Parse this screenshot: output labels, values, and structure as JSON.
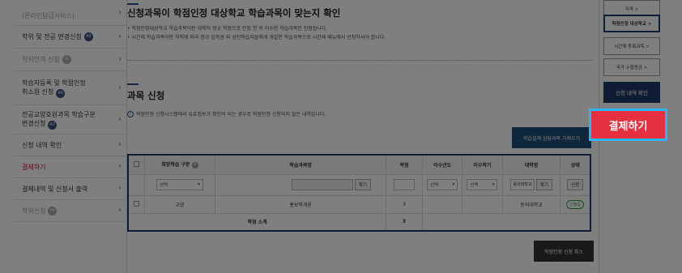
{
  "sidebar": {
    "items": [
      {
        "label1": "",
        "label2": "(온라인탐급서비스)",
        "badge": ""
      },
      {
        "label1": "학위 및 전공 변경신청",
        "label2": "",
        "badge": "A5"
      },
      {
        "label1": "학위연계 신청",
        "label2": "",
        "badge": "Ai"
      },
      {
        "label1": "학습자등록 및 학점인정",
        "label2": "취소원 신청",
        "badge": "A6"
      },
      {
        "label1": "전공교양호원과목 학습구분",
        "label2": "변경신청",
        "badge": "A7"
      },
      {
        "label1": "신청 내역 확인",
        "label2": "",
        "badge": ""
      },
      {
        "label1": "결제하기",
        "label2": "",
        "badge": ""
      },
      {
        "label1": "결제내역 및 신청서 출력",
        "label2": "",
        "badge": ""
      },
      {
        "label1": "학위신청",
        "label2": "",
        "badge": "A6"
      }
    ]
  },
  "section1": {
    "title": "신청과목이 학점인정 대상학교 학습과목이 맞는지 확인",
    "bullets": [
      "학점인정대상학교 학습과목이란 대학의 정규 학점으로 인정 한 후 이수한 학습과목만 인정됩니다.",
      "시간제 학습과목이란 학칙에 따라 정규 입학생 외 성인학습자들에게 개설한 학습과목으로 시간제 메뉴에서 신청하셔야 합니다."
    ]
  },
  "section2": {
    "title": "과목 신청",
    "note": "학점인정 신청시스템에서 유효정보가 확인이 되는 경우로 학점인정 신청되지 않은 내역입니다.",
    "guide_button": "학습설계 상담과목 가져오기"
  },
  "table": {
    "headers": [
      "",
      "희망학습 구분",
      "학습과목명",
      "학점",
      "이수년도",
      "이수학기",
      "대학명",
      "상태"
    ],
    "filter": {
      "select_label": "선택",
      "search_button": "찾기",
      "year_select": "선택",
      "term_select": "선택",
      "univ_value": "동의대학교",
      "univ_button": "찾기",
      "apply_button": "신청"
    },
    "rows": [
      {
        "type": "교양",
        "course": "홍보학개론",
        "credit": "3",
        "year": "",
        "term": "",
        "univ": "동의대학교",
        "status": "신청중"
      }
    ],
    "subtotal_label": "학점 소계",
    "subtotal_value": "3"
  },
  "cancel_button": "학점인정 신청 취소",
  "right_panel": {
    "buttons": [
      "자격 >",
      "학점인정 대상학교 >",
      "시간제 등록과목 >",
      "국가 수할증금 >"
    ],
    "confirm": "신청 내역 확인"
  },
  "pay_button": "결제하기",
  "colors": {
    "accent": "#e63040",
    "highlight": "#29b6f6",
    "navy": "#1f3b68"
  }
}
